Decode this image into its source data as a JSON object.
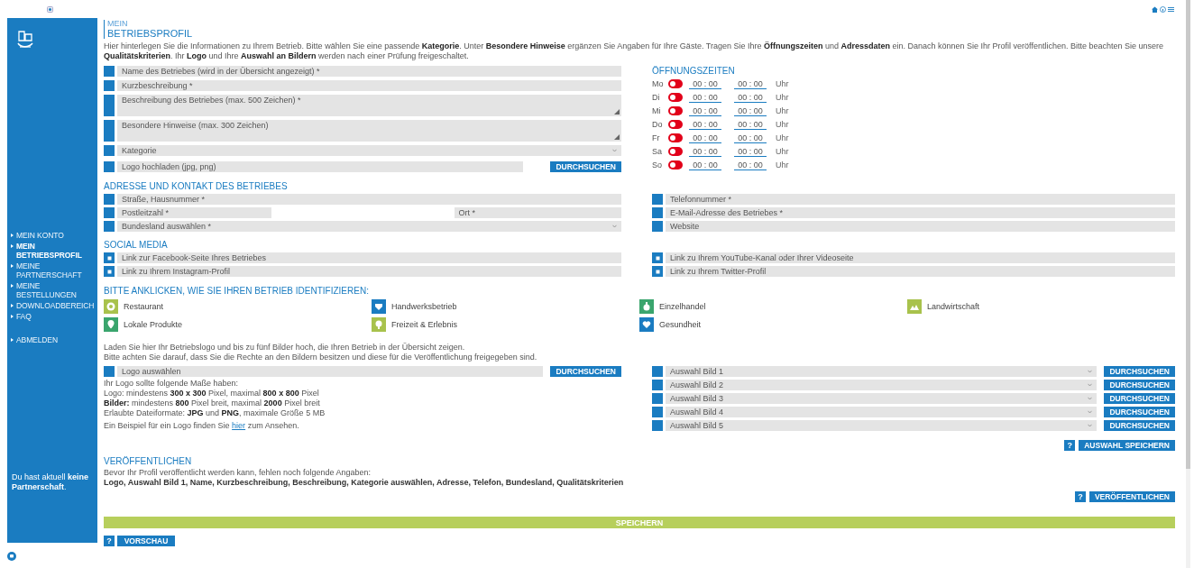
{
  "sidebar": {
    "nav": [
      {
        "label": "MEIN KONTO",
        "selected": false
      },
      {
        "label": "MEIN BETRIEBSPROFIL",
        "selected": true
      },
      {
        "label": "MEINE PARTNERSCHAFT",
        "selected": false
      },
      {
        "label": "MEINE BESTELLUNGEN",
        "selected": false
      },
      {
        "label": "DOWNLOADBEREICH",
        "selected": false
      },
      {
        "label": "FAQ",
        "selected": false
      }
    ],
    "logout": "ABMELDEN",
    "note": "Du hast aktuell **keine Partnerschaft**."
  },
  "header": {
    "kicker": "MEIN",
    "title": "BETRIEBSPROFIL"
  },
  "intro": "Hier hinterlegen Sie die Informationen zu Ihrem Betrieb. Bitte wählen Sie eine passende **Kategorie**. Unter **Besondere Hinweise** ergänzen Sie Angaben für Ihre Gäste. Tragen Sie Ihre **Öffnungszeiten** und **Adressdaten** ein. Danach können Sie Ihr Profil veröffentlichen. Bitte beachten Sie unsere **Qualitätskriterien**. Ihr **Logo** und Ihre **Auswahl an Bildern** werden nach einer Prüfung freigeschaltet.",
  "profile_fields": [
    {
      "kind": "input",
      "placeholder": "Name des Betriebes (wird in der Übersicht angezeigt) *"
    },
    {
      "kind": "input",
      "placeholder": "Kurzbeschreibung *"
    },
    {
      "kind": "textarea",
      "placeholder": "Beschreibung des Betriebes (max. 500 Zeichen) *"
    },
    {
      "kind": "textarea",
      "placeholder": "Besondere Hinweise (max. 300 Zeichen)"
    },
    {
      "kind": "select",
      "placeholder": "Kategorie"
    },
    {
      "kind": "file",
      "placeholder": "Logo hochladen (jpg, png)",
      "button": "DURCHSUCHEN"
    }
  ],
  "opening_hours": {
    "title": "ÖFFNUNGSZEITEN",
    "days": [
      {
        "day": "Mo",
        "on": false,
        "from": "00 : 00",
        "to": "00 : 00",
        "unit": "Uhr"
      },
      {
        "day": "Di",
        "on": false,
        "from": "00 : 00",
        "to": "00 : 00",
        "unit": "Uhr"
      },
      {
        "day": "Mi",
        "on": false,
        "from": "00 : 00",
        "to": "00 : 00",
        "unit": "Uhr"
      },
      {
        "day": "Do",
        "on": false,
        "from": "00 : 00",
        "to": "00 : 00",
        "unit": "Uhr"
      },
      {
        "day": "Fr",
        "on": false,
        "from": "00 : 00",
        "to": "00 : 00",
        "unit": "Uhr"
      },
      {
        "day": "Sa",
        "on": false,
        "from": "00 : 00",
        "to": "00 : 00",
        "unit": "Uhr"
      },
      {
        "day": "So",
        "on": false,
        "from": "00 : 00",
        "to": "00 : 00",
        "unit": "Uhr"
      }
    ]
  },
  "address": {
    "title": "ADRESSE UND KONTAKT DES BETRIEBES",
    "left": [
      [
        {
          "kind": "input",
          "placeholder": "Straße, Hausnummer *"
        }
      ],
      [
        {
          "kind": "input",
          "placeholder": "Postleitzahl *"
        },
        {
          "kind": "input",
          "placeholder": "Ort *"
        }
      ],
      [
        {
          "kind": "select",
          "placeholder": "Bundesland auswählen *"
        }
      ]
    ],
    "right": [
      [
        {
          "kind": "input",
          "placeholder": "Telefonnummer *"
        }
      ],
      [
        {
          "kind": "input",
          "placeholder": "E-Mail-Adresse des Betriebes *"
        }
      ],
      [
        {
          "kind": "input",
          "placeholder": "Website"
        }
      ]
    ]
  },
  "social_media": {
    "title": "SOCIAL MEDIA",
    "left": [
      {
        "placeholder": "Link zur Facebook-Seite Ihres Betriebes"
      },
      {
        "placeholder": "Link zu Ihrem Instagram-Profil"
      }
    ],
    "right": [
      {
        "placeholder": "Link zu Ihrem YouTube-Kanal oder Ihrer Videoseite"
      },
      {
        "placeholder": "Link zu Ihrem Twitter-Profil"
      }
    ]
  },
  "identify": {
    "title": "BITTE ANKLICKEN, WIE SIE IHREN BETRIEB IDENTIFIZIEREN:",
    "categories": [
      {
        "label": "Restaurant",
        "color": "#a8c24c"
      },
      {
        "label": "Handwerksbetrieb",
        "color": "#1a7cc1"
      },
      {
        "label": "Einzelhandel",
        "color": "#3aa56d"
      },
      {
        "label": "Landwirtschaft",
        "color": "#a8c24c"
      },
      {
        "label": "Lokale Produkte",
        "color": "#3aa56d"
      },
      {
        "label": "Freizeit & Erlebnis",
        "color": "#a8c24c"
      },
      {
        "label": "Gesundheit",
        "color": "#1a7cc1"
      }
    ]
  },
  "images": {
    "intro": [
      "Laden Sie hier Ihr Betriebslogo und bis zu fünf Bilder hoch, die Ihren Betrieb in der Übersicht zeigen.",
      "Bitte achten Sie darauf, dass Sie die Rechte an den Bildern besitzen und diese für die Veröffentlichung freigegeben sind."
    ],
    "logo_placeholder": "Logo auswählen",
    "browse_button": "DURCHSUCHEN",
    "notes": [
      "Ihr Logo sollte folgende Maße haben:",
      "Logo: mindestens **300 x 300** Pixel, maximal **800 x 800** Pixel",
      "**Bilder:** mindestens **800** Pixel breit, maximal **2000** Pixel breit",
      "Erlaubte Dateiformate: **JPG** und **PNG**, maximale Größe 5 MB"
    ],
    "example": {
      "before": "Ein Beispiel für ein Logo finden Sie",
      "link": "hier",
      "after": "zum Ansehen."
    },
    "slots": [
      {
        "placeholder": "Auswahl Bild 1",
        "button": "DURCHSUCHEN"
      },
      {
        "placeholder": "Auswahl Bild 2",
        "button": "DURCHSUCHEN"
      },
      {
        "placeholder": "Auswahl Bild 3",
        "button": "DURCHSUCHEN"
      },
      {
        "placeholder": "Auswahl Bild 4",
        "button": "DURCHSUCHEN"
      },
      {
        "placeholder": "Auswahl Bild 5",
        "button": "DURCHSUCHEN"
      }
    ],
    "help": "?",
    "save_button": "AUSWAHL SPEICHERN"
  },
  "publish": {
    "title": "VERÖFFENTLICHEN",
    "text": "Bevor Ihr Profil veröffentlicht werden kann, fehlen noch folgende Angaben:",
    "missing": "Logo, Auswahl Bild 1, Name, Kurzbeschreibung, Beschreibung, Kategorie auswählen, Adresse, Telefon, Bundesland, Qualitätskriterien",
    "help": "?",
    "button": "VERÖFFENTLICHEN"
  },
  "save_bar": "SPEICHERN",
  "back": {
    "help": "?",
    "button": "VORSCHAU"
  }
}
